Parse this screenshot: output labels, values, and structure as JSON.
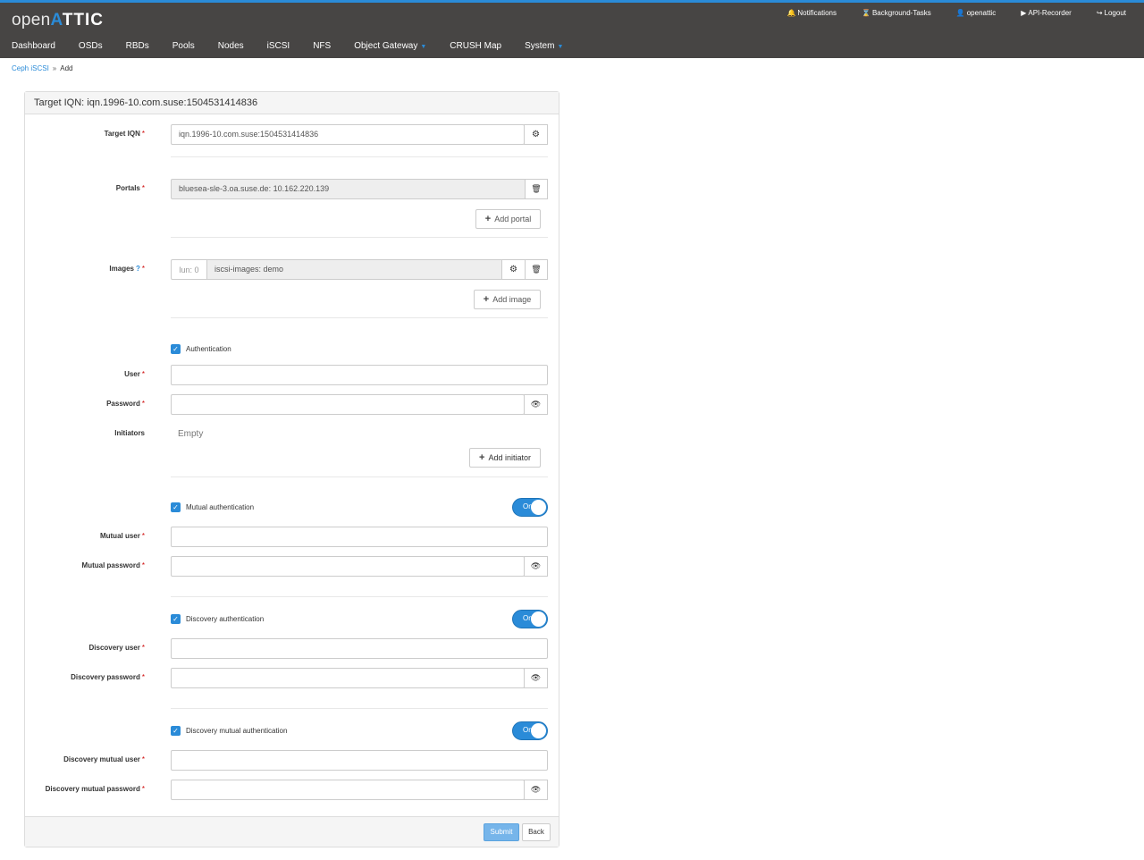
{
  "app": {
    "logo_light": "open",
    "logo_bold_accent": "A",
    "logo_bold": "TTIC"
  },
  "toplinks": [
    {
      "icon": "bell-icon",
      "glyph": "🔔",
      "label": "Notifications"
    },
    {
      "icon": "hourglass-icon",
      "glyph": "⌛",
      "label": "Background-Tasks"
    },
    {
      "icon": "user-icon",
      "glyph": "👤",
      "label": "openattic"
    },
    {
      "icon": "play-icon",
      "glyph": "▶",
      "label": "API-Recorder"
    },
    {
      "icon": "logout-icon",
      "glyph": "↪",
      "label": "Logout"
    }
  ],
  "nav": [
    "Dashboard",
    "OSDs",
    "RBDs",
    "Pools",
    "Nodes",
    "iSCSI",
    "NFS",
    "Object Gateway",
    "CRUSH Map",
    "System"
  ],
  "breadcrumb": {
    "parent": "Ceph iSCSI",
    "sep": "»",
    "current": "Add"
  },
  "panel_title": "Target IQN: iqn.1996-10.com.suse:1504531414836",
  "form": {
    "target_iqn_label": "Target IQN",
    "target_iqn_value": "iqn.1996-10.com.suse:1504531414836",
    "portals_label": "Portals",
    "portal_value": "bluesea-sle-3.oa.suse.de: 10.162.220.139",
    "add_portal": "Add portal",
    "images_label": "Images",
    "image_lun": "lun: 0",
    "image_value": "iscsi-images: demo",
    "add_image": "Add image",
    "authentication": "Authentication",
    "user_label": "User",
    "password_label": "Password",
    "initiators_label": "Initiators",
    "initiators_empty": "Empty",
    "add_initiator": "Add initiator",
    "mutual_auth": "Mutual authentication",
    "mutual_user_label": "Mutual user",
    "mutual_password_label": "Mutual password",
    "discovery_auth": "Discovery authentication",
    "discovery_user_label": "Discovery user",
    "discovery_password_label": "Discovery password",
    "discovery_mutual_auth": "Discovery mutual authentication",
    "discovery_mutual_user_label": "Discovery mutual user",
    "discovery_mutual_password_label": "Discovery mutual password",
    "toggle_on": "On",
    "req": "*",
    "help": "?",
    "check": "✓"
  },
  "actions": {
    "submit": "Submit",
    "back": "Back"
  },
  "colors": {
    "accent": "#2a8bd8",
    "topbar": "#474544"
  }
}
